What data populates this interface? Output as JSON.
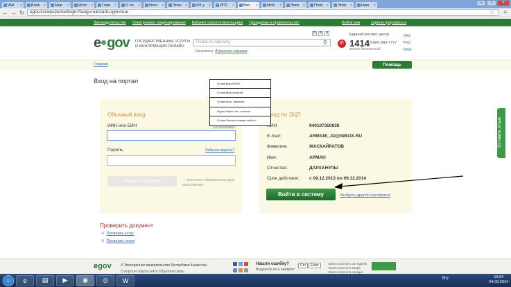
{
  "browser": {
    "tabs": [
      {
        "label": "Wel"
      },
      {
        "label": "Book"
      },
      {
        "label": "Мер"
      },
      {
        "label": "Исто"
      },
      {
        "label": "Глав"
      },
      {
        "label": "О по"
      },
      {
        "label": "Инст"
      },
      {
        "label": "Элек"
      },
      {
        "label": "Об у"
      },
      {
        "label": "ИПС"
      },
      {
        "label": "Вхо"
      },
      {
        "label": "Мой"
      },
      {
        "label": "Элек"
      },
      {
        "label": "Полу"
      },
      {
        "label": "Элек"
      },
      {
        "label": "Ниш"
      }
    ],
    "url": "egov.kz/wps/portal/login?lang=ru&startLogin=true"
  },
  "topnav": {
    "links": [
      "Законодательство",
      "Электронное лицензирование",
      "Кабинет налогоплательщика",
      "Гражданам и правительство"
    ],
    "login": "Войти или",
    "register": "зарегистрироваться"
  },
  "header": {
    "logo_e": "e",
    "logo_gov": "gov",
    "tagline": "ГОСУДАРСТВЕННЫЕ УСЛУГИ И ИНФОРМАЦИЯ ОНЛАЙН",
    "font_sizes": [
      "A",
      "A",
      "A"
    ],
    "search_placeholder": "Поиск по порталу",
    "example_label": "Например,",
    "example_link": "Адресная справка",
    "contact_label": "Единый контакт-центр",
    "contact_number": "1414",
    "contact_alt": "8-800-080-7777",
    "contact_free": "звонок бесплатный",
    "languages": [
      "ҚАЗ",
      "РУС",
      "ENG"
    ]
  },
  "breadcrumb": "Главная",
  "help_button": "Помощь",
  "page_title": "Вход на портал",
  "regular_login": {
    "title": "Обычный вход",
    "iin_label": "ИИН или БИН",
    "register_link": "Регистрация",
    "password_label": "Пароль",
    "forgot_link": "Забыли пароль?",
    "button": "Войти в систему",
    "note": "— все поля обязательны для заполнения"
  },
  "ecp_login": {
    "title": "Вход по ЭЦП",
    "fields": [
      {
        "key": "ИИН:",
        "value": "940107350638"
      },
      {
        "key": "E-mail:",
        "value": "ARMANI_JD@INBOX.RU"
      },
      {
        "key": "Фамилия:",
        "value": "ЖАСКАЙРАТОВ"
      },
      {
        "key": "Имя:",
        "value": "АРМАН"
      },
      {
        "key": "Отчество:",
        "value": "ДАРХАНУЛЫ"
      },
      {
        "key": "Срок действия:",
        "value": "с 09.12.2013 по 09.12.2014"
      }
    ],
    "button": "Войти в систему",
    "other_cert": "Выбрать другой сертификат"
  },
  "popup": {
    "rows": [
      "Отзыв Ваш МЭЕК",
      "Отзыв Ваш оплатой",
      "Отзыв Ваш, Армение",
      "Ждать Ваше чел, отчетов",
      "Отзыв Оплата отзывы тебе пл"
    ]
  },
  "side_tab": "Оставить отзыв",
  "check_document": {
    "title": "Проверить документ",
    "items": [
      "Проверка услуг",
      "Проверка чеков"
    ]
  },
  "footer": {
    "logo": "gov",
    "copyright": "© Электронное правительство Республики Казахстан",
    "links": "О портале    Карта сайта    Обратная связь",
    "error_title": "Нашли ошибку?",
    "error_sub": "Выделите ее и нажмите",
    "key1": "Ctrl",
    "key2": "Enter",
    "visits": [
      "Всего посетило за неделю",
      "Всего посетило вчера",
      "Всего посетило сегодня"
    ]
  },
  "taskbar": {
    "lang": "RU",
    "time": "16:04",
    "date": "04.03.2014"
  },
  "colors": {
    "brand_green": "#2e7b38",
    "accent_orange": "#e08a3c",
    "link_blue": "#2e6ab0"
  }
}
